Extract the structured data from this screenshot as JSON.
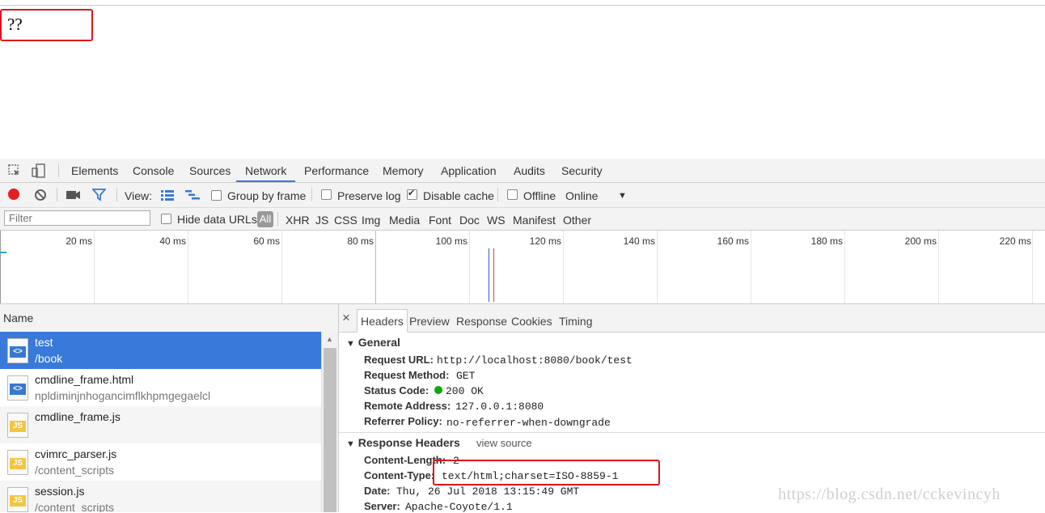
{
  "page": {
    "body_text": "??"
  },
  "devtools": {
    "tabs": [
      "Elements",
      "Console",
      "Sources",
      "Network",
      "Performance",
      "Memory",
      "Application",
      "Audits",
      "Security"
    ],
    "active_tab": "Network",
    "icons": {
      "inspect": "inspect-element-icon",
      "device": "device-toolbar-icon"
    }
  },
  "toolbar": {
    "view_label": "View:",
    "group_by_frame": "Group by frame",
    "preserve_log": "Preserve log",
    "disable_cache": "Disable cache",
    "offline": "Offline",
    "throttling": "Online",
    "group_by_frame_checked": false,
    "preserve_log_checked": false,
    "disable_cache_checked": true,
    "offline_checked": false
  },
  "filter_bar": {
    "placeholder": "Filter",
    "hide_data_urls": "Hide data URLs",
    "types": [
      "All",
      "XHR",
      "JS",
      "CSS",
      "Img",
      "Media",
      "Font",
      "Doc",
      "WS",
      "Manifest",
      "Other"
    ]
  },
  "timeline": {
    "ticks": [
      "20 ms",
      "40 ms",
      "60 ms",
      "80 ms",
      "100 ms",
      "120 ms",
      "140 ms",
      "160 ms",
      "180 ms",
      "200 ms",
      "220 ms"
    ]
  },
  "requests": {
    "column_name": "Name",
    "rows": [
      {
        "name": "test",
        "path": "/book",
        "kind": "html",
        "selected": true
      },
      {
        "name": "cmdline_frame.html",
        "path": "npldiminjnhogancimflkhpmgegaelcl",
        "kind": "html",
        "selected": false
      },
      {
        "name": "cmdline_frame.js",
        "path": "",
        "kind": "js",
        "selected": false
      },
      {
        "name": "cvimrc_parser.js",
        "path": "/content_scripts",
        "kind": "js",
        "selected": false
      },
      {
        "name": "session.js",
        "path": "/content_scripts",
        "kind": "js",
        "selected": false
      }
    ]
  },
  "detail": {
    "close": "×",
    "tabs": [
      "Headers",
      "Preview",
      "Response",
      "Cookies",
      "Timing"
    ],
    "active_tab": "Headers",
    "general": {
      "title": "General",
      "request_url_key": "Request URL:",
      "request_url": "http://localhost:8080/book/test",
      "request_method_key": "Request Method:",
      "request_method": "GET",
      "status_code_key": "Status Code:",
      "status_code": "200 OK",
      "remote_address_key": "Remote Address:",
      "remote_address": "127.0.0.1:8080",
      "referrer_policy_key": "Referrer Policy:",
      "referrer_policy": "no-referrer-when-downgrade"
    },
    "response_headers": {
      "title": "Response Headers",
      "view_source": "view source",
      "content_length_key": "Content-Length:",
      "content_length": "2",
      "content_type_key": "Content-Type:",
      "content_type": "text/html;charset=ISO-8859-1",
      "date_key": "Date:",
      "date": "Thu, 26 Jul 2018 13:15:49 GMT",
      "server_key": "Server:",
      "server": "Apache-Coyote/1.1"
    }
  },
  "watermark": "https://blog.csdn.net/cckevincyh",
  "colors": {
    "accent": "#3879d9",
    "record": "#e51e23",
    "highlight": "#e0141c",
    "status_ok": "#0aa80a"
  }
}
